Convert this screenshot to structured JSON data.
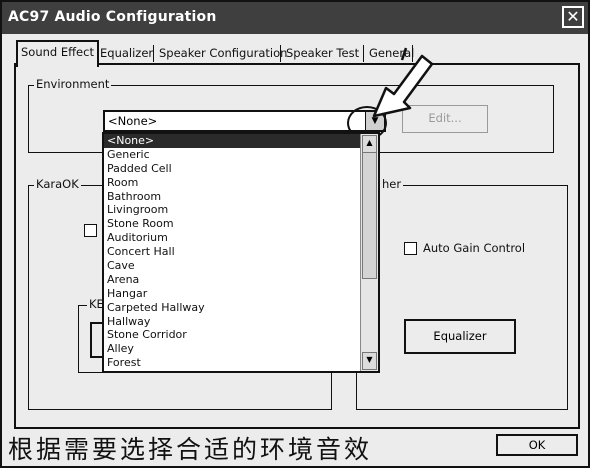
{
  "window": {
    "title": "AC97 Audio Configuration",
    "close_glyph": "✕"
  },
  "tabs": [
    {
      "label": "Sound Effect",
      "active": true
    },
    {
      "label": "Equalizer"
    },
    {
      "label": "Speaker Configuration"
    },
    {
      "label": "Speaker Test"
    },
    {
      "label": "General"
    }
  ],
  "environment": {
    "group_label": "Environment",
    "selected_value": "<None>",
    "edit_button": "Edit...",
    "options": [
      "<None>",
      "Generic",
      "Padded Cell",
      "Room",
      "Bathroom",
      "Livingroom",
      "Stone Room",
      "Auditorium",
      "Concert Hall",
      "Cave",
      "Arena",
      "Hangar",
      "Carpeted Hallway",
      "Hallway",
      "Stone Corridor",
      "Alley",
      "Forest"
    ]
  },
  "karaok": {
    "group_label": "KaraOK",
    "sub_label": "KE"
  },
  "other": {
    "group_label": "her",
    "auto_gain_label": "Auto Gain Control",
    "equalizer_button": "Equalizer"
  },
  "caption": "根据需要选择合适的环境音效",
  "ok_button": "OK",
  "icons": {
    "dropdown": "chevron-down-icon",
    "pointer": "arrow-pointer-icon"
  }
}
